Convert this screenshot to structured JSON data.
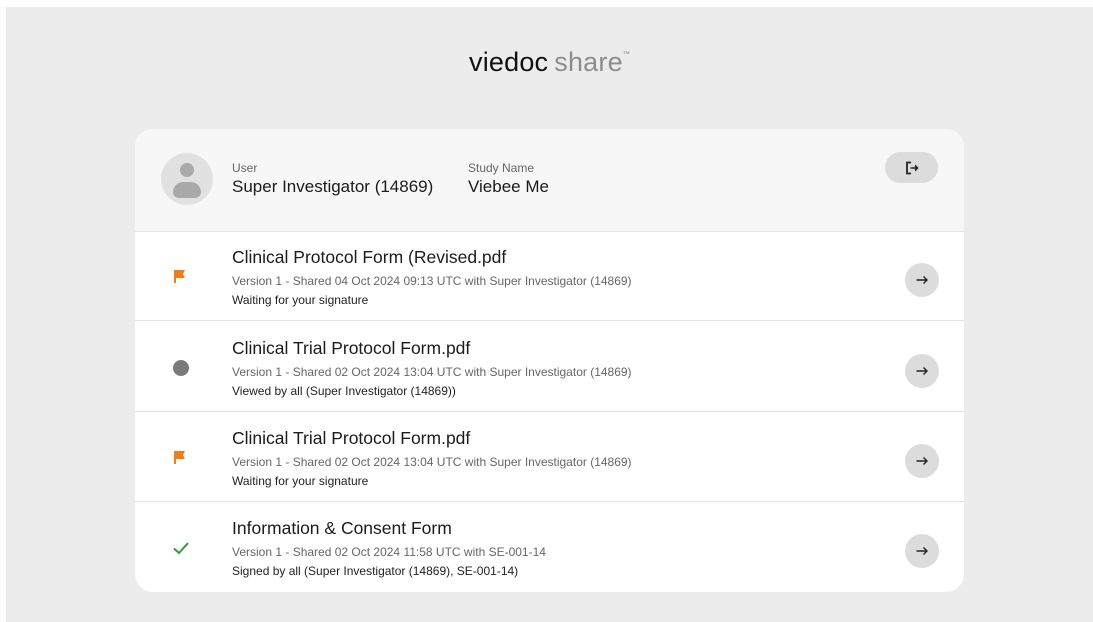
{
  "brand": {
    "part1": "viedoc",
    "part2": "share",
    "tm": "™"
  },
  "header": {
    "user_label": "User",
    "user_value": "Super Investigator (14869)",
    "study_label": "Study Name",
    "study_value": "Viebee Me",
    "avatar_icon": "user-avatar-icon",
    "logout_icon": "logout-icon"
  },
  "colors": {
    "flag": "#f07d1a",
    "viewed_dot": "#7a7a7a",
    "check": "#2e9a3e",
    "button_bg": "#dcdcdc",
    "page_bg": "#ececec"
  },
  "documents": [
    {
      "status_icon": "flag-icon",
      "title": "Clinical Protocol Form (Revised.pdf",
      "meta": "Version 1 - Shared 04 Oct 2024 09:13 UTC with Super Investigator (14869)",
      "status": "Waiting for your signature",
      "action_icon": "arrow-right-icon"
    },
    {
      "status_icon": "viewed-dot-icon",
      "title": "Clinical Trial Protocol Form.pdf",
      "meta": "Version 1 - Shared 02 Oct 2024 13:04 UTC with Super Investigator (14869)",
      "status": "Viewed by all (Super Investigator (14869))",
      "action_icon": "arrow-right-icon"
    },
    {
      "status_icon": "flag-icon",
      "title": "Clinical Trial Protocol Form.pdf",
      "meta": "Version 1 - Shared 02 Oct 2024 13:04 UTC with Super Investigator (14869)",
      "status": "Waiting for your signature",
      "action_icon": "arrow-right-icon"
    },
    {
      "status_icon": "check-icon",
      "title": "Information & Consent Form",
      "meta": "Version 1 - Shared 02 Oct 2024 11:58 UTC with SE-001-14",
      "status": "Signed by all (Super Investigator (14869), SE-001-14)",
      "action_icon": "arrow-right-icon"
    }
  ]
}
